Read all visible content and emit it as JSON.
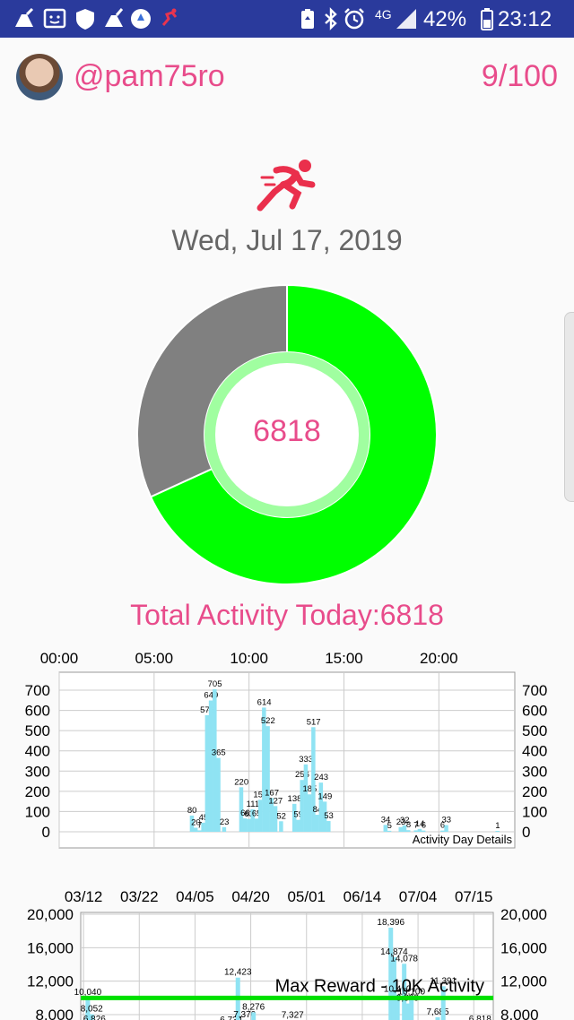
{
  "status_bar": {
    "network": "4G",
    "battery": "42%",
    "time": "23:12",
    "icons": [
      "cleaner-icon",
      "notification-icon",
      "shield-icon",
      "broom-icon",
      "app-icon",
      "runner-app-icon",
      "battery-saver-icon",
      "bluetooth-icon",
      "alarm-icon",
      "signal-icon",
      "battery-icon"
    ]
  },
  "header": {
    "username": "@pam75ro",
    "progress": "9/100"
  },
  "summary": {
    "date": "Wed, Jul 17, 2019",
    "value": "6818",
    "total_label": "Total Activity Today:6818",
    "colors": {
      "accent": "#e84c8b",
      "done": "#00ff00",
      "remaining": "#808080"
    }
  },
  "chart_data": [
    {
      "type": "bar",
      "title": "Activity Day Details",
      "x_ticks": [
        "00:00",
        "05:00",
        "10:00",
        "15:00",
        "20:00"
      ],
      "y_ticks": [
        "0",
        "100",
        "200",
        "300",
        "400",
        "500",
        "600",
        "700"
      ],
      "ylim": [
        0,
        700
      ],
      "xlim_hours": [
        0,
        24
      ],
      "bars": [
        {
          "h": 7.0,
          "v": 80
        },
        {
          "h": 7.2,
          "v": 20
        },
        {
          "h": 7.4,
          "v": 7
        },
        {
          "h": 7.6,
          "v": 45
        },
        {
          "h": 7.8,
          "v": 576
        },
        {
          "h": 8.0,
          "v": 649
        },
        {
          "h": 8.2,
          "v": 705
        },
        {
          "h": 8.4,
          "v": 365
        },
        {
          "h": 8.7,
          "v": 23
        },
        {
          "h": 9.6,
          "v": 220
        },
        {
          "h": 9.8,
          "v": 66
        },
        {
          "h": 10.0,
          "v": 63
        },
        {
          "h": 10.2,
          "v": 111
        },
        {
          "h": 10.4,
          "v": 65
        },
        {
          "h": 10.6,
          "v": 158
        },
        {
          "h": 10.8,
          "v": 614
        },
        {
          "h": 11.0,
          "v": 522
        },
        {
          "h": 11.2,
          "v": 167
        },
        {
          "h": 11.4,
          "v": 127
        },
        {
          "h": 11.7,
          "v": 52
        },
        {
          "h": 12.4,
          "v": 138
        },
        {
          "h": 12.6,
          "v": 59
        },
        {
          "h": 12.8,
          "v": 256
        },
        {
          "h": 13.0,
          "v": 333
        },
        {
          "h": 13.2,
          "v": 185
        },
        {
          "h": 13.4,
          "v": 517
        },
        {
          "h": 13.6,
          "v": 84
        },
        {
          "h": 13.8,
          "v": 243
        },
        {
          "h": 14.0,
          "v": 149
        },
        {
          "h": 14.2,
          "v": 53
        },
        {
          "h": 17.2,
          "v": 34
        },
        {
          "h": 17.4,
          "v": 5
        },
        {
          "h": 18.0,
          "v": 23
        },
        {
          "h": 18.2,
          "v": 32
        },
        {
          "h": 18.4,
          "v": 8
        },
        {
          "h": 18.8,
          "v": 7
        },
        {
          "h": 19.0,
          "v": 14
        },
        {
          "h": 19.2,
          "v": 6
        },
        {
          "h": 20.2,
          "v": 6
        },
        {
          "h": 20.4,
          "v": 33
        },
        {
          "h": 23.1,
          "v": 1
        }
      ]
    },
    {
      "type": "bar",
      "x_ticks": [
        "03/12",
        "03/22",
        "04/05",
        "04/20",
        "05/01",
        "06/14",
        "07/04",
        "07/15"
      ],
      "y_ticks": [
        "8,000",
        "12,000",
        "16,000",
        "20,000"
      ],
      "ylim": [
        8000,
        20000
      ],
      "reference_line": {
        "value": 10000,
        "label": "Max Reward - 10K Activity",
        "color": "#00e000"
      },
      "bars": [
        {
          "d": 0.3,
          "v": 10040
        },
        {
          "d": 1.0,
          "v": 8052
        },
        {
          "d": 1.5,
          "v": 6826
        },
        {
          "d": 26.0,
          "v": 6734
        },
        {
          "d": 27.2,
          "v": 12423
        },
        {
          "d": 28.4,
          "v": 7370
        },
        {
          "d": 30.0,
          "v": 8276
        },
        {
          "d": 37.0,
          "v": 7327
        },
        {
          "d": 54.6,
          "v": 18396
        },
        {
          "d": 55.2,
          "v": 14874
        },
        {
          "d": 55.8,
          "v": 10400
        },
        {
          "d": 57.0,
          "v": 14078
        },
        {
          "d": 57.6,
          "v": 9329
        },
        {
          "d": 58.3,
          "v": 10100
        },
        {
          "d": 63.0,
          "v": 7685
        },
        {
          "d": 64.0,
          "v": 11391
        },
        {
          "d": 70.6,
          "v": 6818
        }
      ]
    }
  ]
}
